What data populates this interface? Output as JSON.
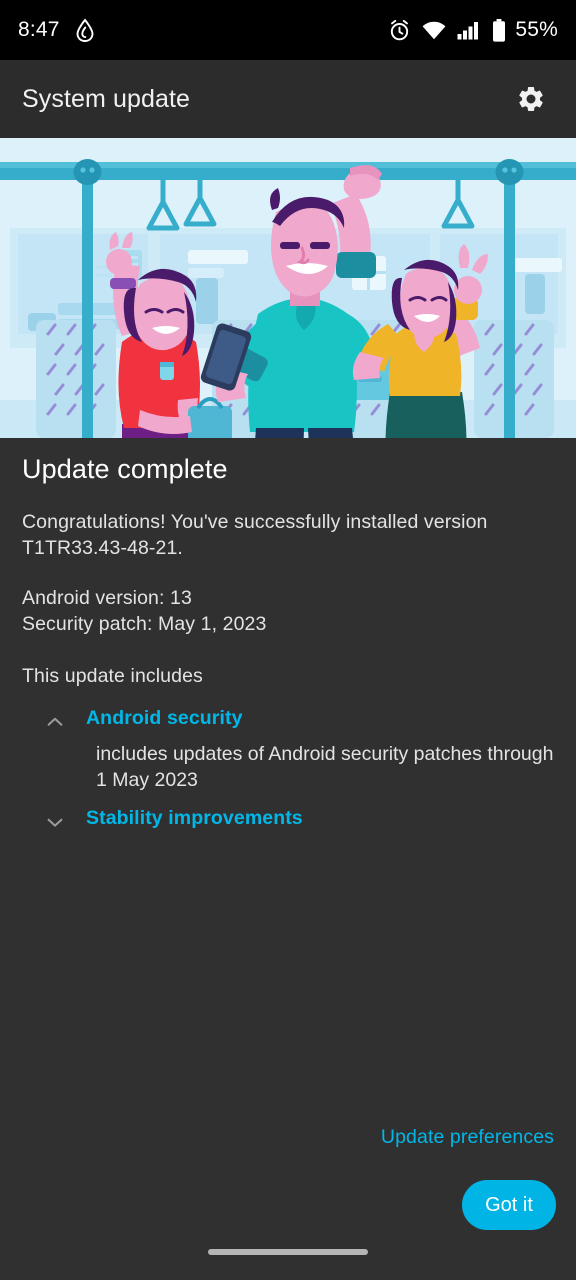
{
  "status_bar": {
    "time": "8:47",
    "battery_percent": "55%",
    "icons": [
      "water-drop-icon",
      "alarm-icon",
      "wifi-icon",
      "cellular-signal-icon",
      "battery-icon"
    ]
  },
  "app_bar": {
    "title": "System update",
    "settings_icon": "gear-icon"
  },
  "hero": {
    "illustration": "people-celebrating-on-train-illustration",
    "background_color": "#ddf1fb"
  },
  "main": {
    "title": "Update complete",
    "congratulations": "Congratulations! You've successfully installed version T1TR33.43-48-21.",
    "android_version": "Android version: 13",
    "security_patch": "Security patch: May 1, 2023",
    "includes_label": "This update includes",
    "accordion": [
      {
        "title": "Android security",
        "expanded": true,
        "chevron": "chevron-up-icon",
        "body": "includes updates of Android security patches through 1 May 2023"
      },
      {
        "title": "Stability improvements",
        "expanded": false,
        "chevron": "chevron-down-icon",
        "body": ""
      }
    ]
  },
  "footer": {
    "preferences_link": "Update preferences",
    "primary_button": "Got it"
  },
  "colors": {
    "accent": "#00b7e8",
    "button": "#00b4e6",
    "background": "#303030",
    "app_bar": "#2c2c2c",
    "status_bar": "#000000"
  }
}
